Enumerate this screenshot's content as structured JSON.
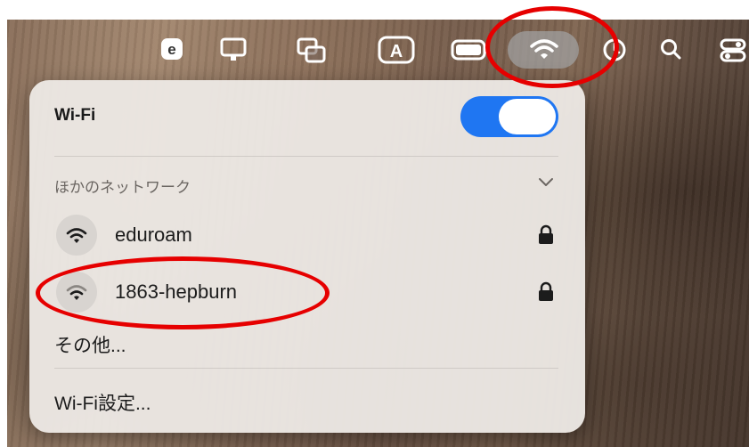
{
  "menubar": {
    "icons": [
      "e-badge-icon",
      "display-icon",
      "stage-manager-icon",
      "input-source-icon",
      "battery-icon",
      "wifi-icon",
      "clock-icon",
      "search-icon",
      "control-center-icon"
    ],
    "input_source_letter": "A",
    "e_letter": "e"
  },
  "wifi_panel": {
    "title": "Wi-Fi",
    "toggle_on": true,
    "section_header": "ほかのネットワーク",
    "networks": [
      {
        "name": "eduroam",
        "secured": true
      },
      {
        "name": "1863-hepburn",
        "secured": true
      }
    ],
    "other_label": "その他...",
    "settings_label": "Wi-Fi設定..."
  },
  "colors": {
    "accent": "#1f76f2",
    "annotation": "#e60000"
  }
}
